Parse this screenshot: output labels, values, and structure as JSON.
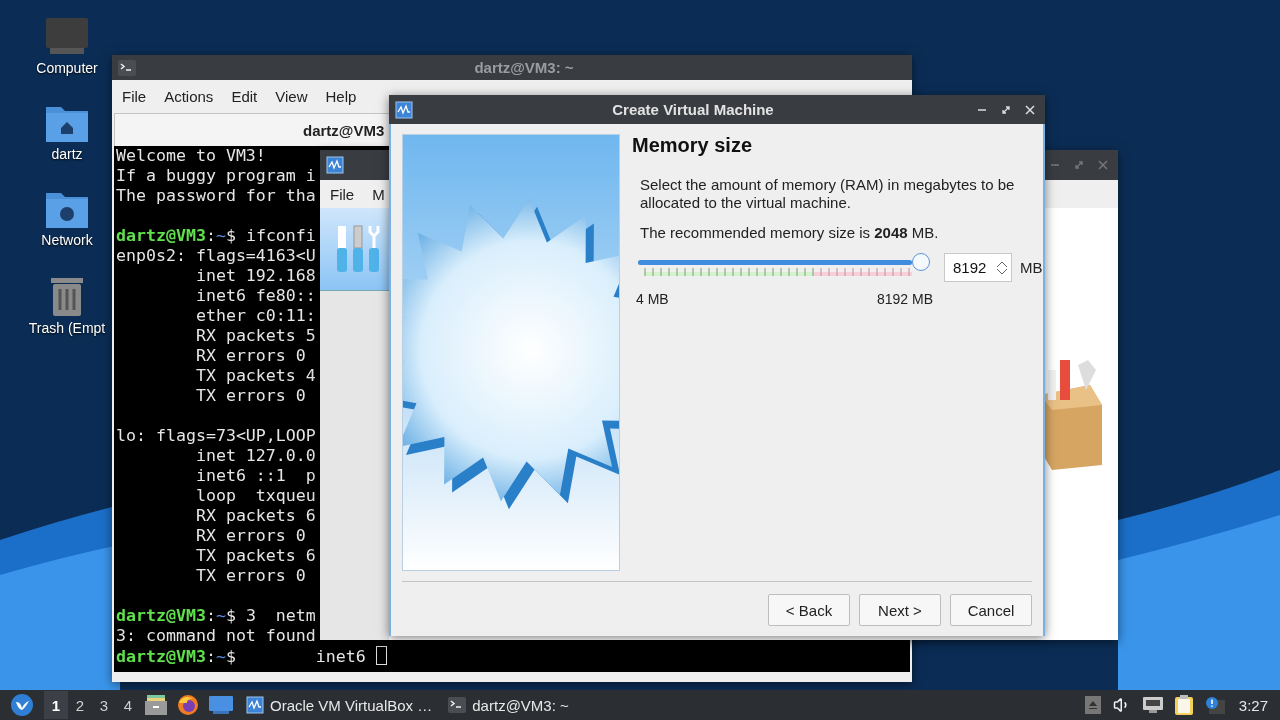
{
  "desktop": {
    "icons": [
      {
        "label": "Computer",
        "kind": "computer"
      },
      {
        "label": "dartz",
        "kind": "home"
      },
      {
        "label": "Network",
        "kind": "network"
      },
      {
        "label": "Trash (Empt",
        "kind": "trash"
      }
    ]
  },
  "terminal": {
    "title": "dartz@VM3: ~",
    "menu": [
      "File",
      "Actions",
      "Edit",
      "View",
      "Help"
    ],
    "tab": "dartz@VM3",
    "lines": [
      {
        "kind": "output",
        "text": "Welcome to VM3!"
      },
      {
        "kind": "output",
        "text": "If a buggy program i"
      },
      {
        "kind": "output",
        "text": "The password for tha"
      },
      {
        "kind": "blank"
      },
      {
        "kind": "prompt",
        "user": "dartz@VM3",
        "colon": ":",
        "path": "~",
        "text": "$ ifconfi",
        "cursor": false
      },
      {
        "kind": "output",
        "text": "enp0s2: flags=4163<U"
      },
      {
        "kind": "output",
        "text": "        inet 192.168"
      },
      {
        "kind": "output",
        "text": "        inet6 fe80::"
      },
      {
        "kind": "output",
        "text": "        ether c0:11:"
      },
      {
        "kind": "output",
        "text": "        RX packets 5"
      },
      {
        "kind": "output",
        "text": "        RX errors 0"
      },
      {
        "kind": "output",
        "text": "        TX packets 4"
      },
      {
        "kind": "output",
        "text": "        TX errors 0"
      },
      {
        "kind": "blank"
      },
      {
        "kind": "output",
        "text": "lo: flags=73<UP,LOOP"
      },
      {
        "kind": "output",
        "text": "        inet 127.0.0"
      },
      {
        "kind": "output",
        "text": "        inet6 ::1  p"
      },
      {
        "kind": "output",
        "text": "        loop  txqueu"
      },
      {
        "kind": "output",
        "text": "        RX packets 6"
      },
      {
        "kind": "output",
        "text": "        RX errors 0"
      },
      {
        "kind": "output",
        "text": "        TX packets 6"
      },
      {
        "kind": "output",
        "text": "        TX errors 0"
      },
      {
        "kind": "blank"
      },
      {
        "kind": "prompt",
        "user": "dartz@VM3",
        "colon": ":",
        "path": "~",
        "text": "$ 3  netm",
        "cursor": false
      },
      {
        "kind": "output",
        "text": "3: command not found"
      },
      {
        "kind": "prompt",
        "user": "dartz@VM3",
        "colon": ":",
        "path": "~",
        "text": "$        inet6 ",
        "cursor": true
      }
    ]
  },
  "manager": {
    "menu": [
      "File",
      "M"
    ]
  },
  "dialog": {
    "title": "Create Virtual Machine",
    "heading": "Memory size",
    "description": "Select the amount of memory (RAM) in megabytes to be allocated to the virtual machine.",
    "recommendation": "The recommended memory size is **2048** MB.",
    "slider": {
      "level": 1.0,
      "min_label": "4 MB",
      "max_label": "8192 MB"
    },
    "spin_value": "8192",
    "unit": "MB",
    "buttons": [
      {
        "label": "< Back"
      },
      {
        "label": "Next >"
      },
      {
        "label": "Cancel"
      }
    ]
  },
  "taskbar": {
    "workspaces": [
      {
        "label": "1",
        "selected": true
      },
      {
        "label": "2",
        "selected": false
      },
      {
        "label": "3",
        "selected": false
      },
      {
        "label": "4",
        "selected": false
      }
    ],
    "tasks": [
      {
        "label": "Oracle VM VirtualBox …",
        "kind": "virtualbox"
      },
      {
        "label": "dartz@VM3: ~",
        "kind": "terminal"
      }
    ],
    "clock": "3:27"
  }
}
